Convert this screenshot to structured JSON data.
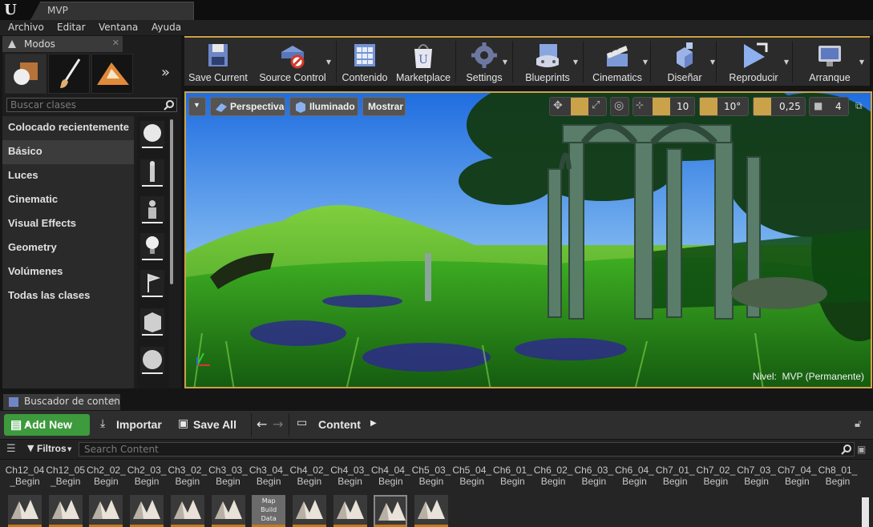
{
  "window": {
    "tab_title": "MVP"
  },
  "menu": [
    "Archivo",
    "Editar",
    "Ventana",
    "Ayuda"
  ],
  "modes": {
    "tab_label": "Modos",
    "search_placeholder": "Buscar clases",
    "categories": [
      "Colocado recientemente",
      "Básico",
      "Luces",
      "Cinematic",
      "Visual Effects",
      "Geometry",
      "Volúmenes",
      "Todas las clases"
    ],
    "selected_category": "Básico"
  },
  "toolbar": {
    "buttons": [
      "Save Current",
      "Source Control",
      "Contenido",
      "Marketplace",
      "Settings",
      "Blueprints",
      "Cinematics",
      "Diseñar",
      "Reproducir",
      "Arranque"
    ]
  },
  "viewport": {
    "perspective": "Perspectiva",
    "lit": "Iluminado",
    "show": "Mostrar",
    "grid_snap": "10",
    "rot_snap": "10°",
    "scale_snap": "0,25",
    "cam_speed": "4",
    "level_label": "Nivel:",
    "level_name": "MVP (Permanente)"
  },
  "content_browser": {
    "tab_label": "Buscador de contenido",
    "add_new": "Add New",
    "import": "Importar",
    "save_all": "Save All",
    "path": "Content",
    "filters": "Filtros",
    "search_placeholder": "Search Content",
    "assets": [
      [
        "Ch12_04",
        "_Begin"
      ],
      [
        "Ch12_05",
        "_Begin"
      ],
      [
        "Ch2_02_",
        "Begin"
      ],
      [
        "Ch2_03_",
        "Begin"
      ],
      [
        "Ch3_02_",
        "Begin"
      ],
      [
        "Ch3_03_",
        "Begin"
      ],
      [
        "Ch3_04_",
        "Begin"
      ],
      [
        "Ch4_02_",
        "Begin"
      ],
      [
        "Ch4_03_",
        "Begin"
      ],
      [
        "Ch4_04_",
        "Begin"
      ],
      [
        "Ch5_03_",
        "Begin"
      ],
      [
        "Ch5_04_",
        "Begin"
      ],
      [
        "Ch6_01_",
        "Begin"
      ],
      [
        "Ch6_02_",
        "Begin"
      ],
      [
        "Ch6_03_",
        "Begin"
      ],
      [
        "Ch6_04_",
        "Begin"
      ],
      [
        "Ch7_01_",
        "Begin"
      ],
      [
        "Ch7_02_",
        "Begin"
      ],
      [
        "Ch7_03_",
        "Begin"
      ],
      [
        "Ch7_04_",
        "Begin"
      ],
      [
        "Ch8_01_",
        "Begin"
      ]
    ],
    "map_build_data_label": "Map\nBuild\nData"
  },
  "colors": {
    "accent": "#caa24a",
    "add_new_green": "#3d9a3d",
    "level_orange": "#c47a18"
  },
  "icons": [
    "unreal-logo-icon",
    "save-icon",
    "source-control-icon",
    "content-icon",
    "marketplace-icon",
    "settings-icon",
    "blueprints-icon",
    "cinematics-icon",
    "build-icon",
    "play-icon",
    "launch-icon"
  ]
}
